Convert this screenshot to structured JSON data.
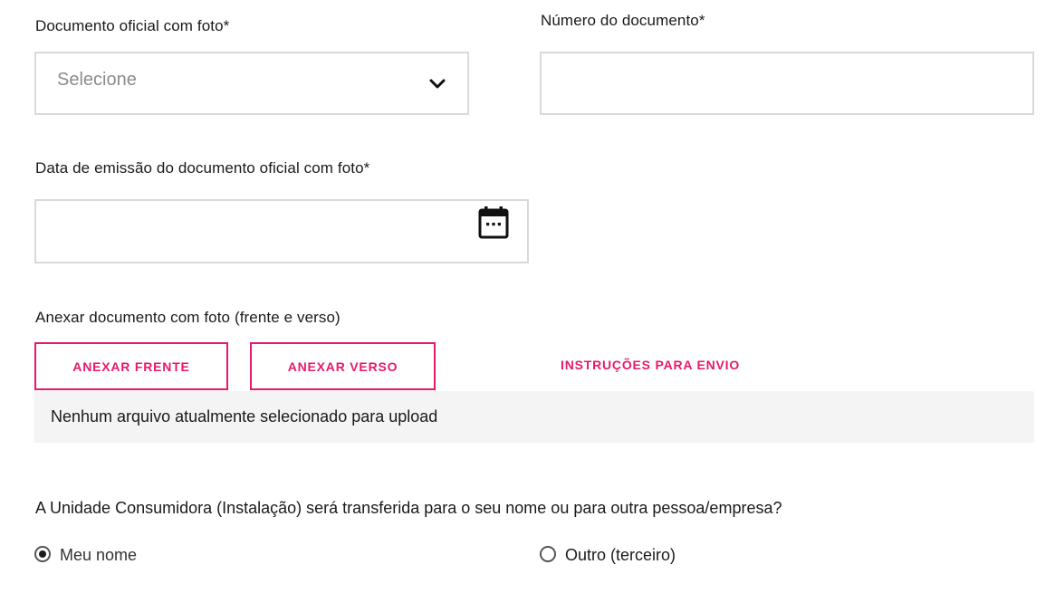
{
  "document_type": {
    "label": "Documento oficial com foto*",
    "placeholder": "Selecione",
    "icon": "chevron-down-icon"
  },
  "document_number": {
    "label": "Número do documento*",
    "value": ""
  },
  "issue_date": {
    "label": "Data de emissão do documento oficial com foto*",
    "value": "",
    "icon": "calendar-icon"
  },
  "attachments": {
    "label": "Anexar documento com foto (frente e verso)",
    "front_button": "ANEXAR FRENTE",
    "back_button": "ANEXAR VERSO",
    "instructions_link": "INSTRUÇÕES PARA ENVIO",
    "status": "Nenhum arquivo atualmente selecionado para upload"
  },
  "transfer": {
    "question": "A Unidade Consumidora (Instalação) será transferida para o seu nome ou para outra pessoa/empresa?",
    "options": [
      {
        "label": "Meu nome",
        "selected": true
      },
      {
        "label": "Outro (terceiro)",
        "selected": false
      }
    ]
  },
  "colors": {
    "accent": "#e8196b",
    "border": "#d9d9d9",
    "status_background": "#f4f4f4"
  }
}
